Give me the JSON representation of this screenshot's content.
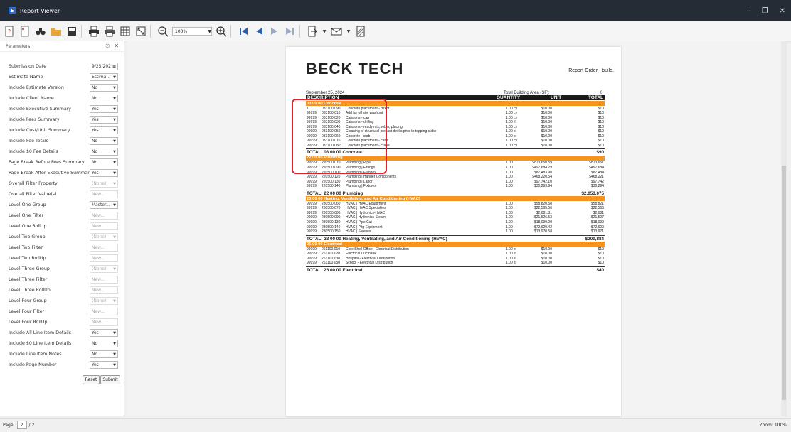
{
  "window": {
    "title": "Report Viewer",
    "app_icon_letter": "E"
  },
  "toolbar": {
    "zoom": "100%"
  },
  "params": {
    "header": "Parameters",
    "rows": [
      {
        "label": "Submission Date",
        "value": "9/25/202",
        "kind": "date",
        "enabled": true
      },
      {
        "label": "Estimate Name",
        "value": "Estima...",
        "kind": "select",
        "enabled": true
      },
      {
        "label": "Include Estimate Version",
        "value": "No",
        "kind": "select",
        "enabled": true
      },
      {
        "label": "Include Client Name",
        "value": "No",
        "kind": "select",
        "enabled": true
      },
      {
        "label": "Include Executive Summary",
        "value": "Yes",
        "kind": "select",
        "enabled": true
      },
      {
        "label": "Include Fees Summary",
        "value": "Yes",
        "kind": "select",
        "enabled": true
      },
      {
        "label": "Include Cost/Unit Summary",
        "value": "Yes",
        "kind": "select",
        "enabled": true
      },
      {
        "label": "Include Fee Totals",
        "value": "No",
        "kind": "select",
        "enabled": true
      },
      {
        "label": "Include $0 Fee Details",
        "value": "No",
        "kind": "select",
        "enabled": true
      },
      {
        "label": "Page Break Before Fees Summary",
        "value": "No",
        "kind": "select",
        "enabled": true
      },
      {
        "label": "Page Break After Executive Summary",
        "value": "Yes",
        "kind": "select",
        "enabled": true
      },
      {
        "label": "Overall Filter Property",
        "value": "(None)",
        "kind": "select",
        "enabled": false
      },
      {
        "label": "Overall Filter Value(s)",
        "value": "New...",
        "kind": "text",
        "enabled": false
      },
      {
        "label": "Level One Group",
        "value": "Master...",
        "kind": "select",
        "enabled": true
      },
      {
        "label": "Level One Filter",
        "value": "New...",
        "kind": "text",
        "enabled": false
      },
      {
        "label": "Level One RollUp",
        "value": "New...",
        "kind": "text",
        "enabled": false
      },
      {
        "label": "Level Two Group",
        "value": "(None)",
        "kind": "select",
        "enabled": false
      },
      {
        "label": "Level Two Filter",
        "value": "New...",
        "kind": "text",
        "enabled": false
      },
      {
        "label": "Level Two RollUp",
        "value": "New...",
        "kind": "text",
        "enabled": false
      },
      {
        "label": "Level Three Group",
        "value": "(None)",
        "kind": "select",
        "enabled": false
      },
      {
        "label": "Level Three Filter",
        "value": "New...",
        "kind": "text",
        "enabled": false
      },
      {
        "label": "Level Three RollUp",
        "value": "New...",
        "kind": "text",
        "enabled": false
      },
      {
        "label": "Level Four Group",
        "value": "(None)",
        "kind": "select",
        "enabled": false
      },
      {
        "label": "Level Four Filter",
        "value": "New...",
        "kind": "text",
        "enabled": false
      },
      {
        "label": "Level Four RollUp",
        "value": "New...",
        "kind": "text",
        "enabled": false
      },
      {
        "label": "Include All Line Item Details",
        "value": "Yes",
        "kind": "select",
        "enabled": true
      },
      {
        "label": "Include $0 Line Item Details",
        "value": "No",
        "kind": "select",
        "enabled": true
      },
      {
        "label": "Include Line Item Notes",
        "value": "No",
        "kind": "select",
        "enabled": true
      },
      {
        "label": "Include Page Number",
        "value": "Yes",
        "kind": "select",
        "enabled": true
      }
    ],
    "reset_label": "Reset",
    "submit_label": "Submit"
  },
  "report": {
    "logo": "BECK TECH",
    "title": "Report Order - build.",
    "date": "September 25, 2024",
    "area_label": "Total Building Area (SF):",
    "area_value": "0",
    "columns": [
      "DESCRIPTION",
      "QUANTITY",
      "UNIT",
      "TOTAL"
    ],
    "sections": [
      {
        "title": "03 00 00 Concrete",
        "lines": [
          [
            "1",
            "033100.090",
            "Concrete placement - direct",
            "1.00 cy",
            "$10.00",
            "$10"
          ],
          [
            "99999",
            "033100.010",
            "Add for off site washout",
            "1.00 cy",
            "$10.00",
            "$10"
          ],
          [
            "99999",
            "033100.020",
            "Caissons - cap",
            "1.00 cy",
            "$10.00",
            "$10"
          ],
          [
            "99999",
            "033100.030",
            "Caissons - drilling",
            "1.00 lf",
            "$10.00",
            "$10"
          ],
          [
            "99999",
            "033100.040",
            "Caissons - ready-mix, rebar, placing",
            "1.00 cy",
            "$10.00",
            "$10"
          ],
          [
            "99999",
            "033100.050",
            "Cleaning of structural precast decks prior to topping slabs",
            "1.00 sf",
            "$10.00",
            "$10"
          ],
          [
            "99999",
            "033100.060",
            "Concrete - curb",
            "1.00 sf",
            "$10.00",
            "$10"
          ],
          [
            "99999",
            "033100.070",
            "Concrete placement - carts",
            "1.00 cy",
            "$10.00",
            "$10"
          ],
          [
            "99999",
            "033100.080",
            "Concrete placement - crane",
            "1.00 cy",
            "$10.00",
            "$10"
          ]
        ],
        "total_label": "TOTAL: 03 00 00 Concrete",
        "total": "$90"
      },
      {
        "title": "22 00 00 Plumbing",
        "lines": [
          [
            "99999",
            "220500.070",
            "Plumbing | Pipe",
            "1.00 .",
            "$873,650.59",
            "$873,651"
          ],
          [
            "99999",
            "220500.090",
            "Plumbing | Fittings",
            "1.00 .",
            "$497,684.29",
            "$497,684"
          ],
          [
            "99999",
            "220500.100",
            "Plumbing | Flanges",
            "1.00 .",
            "$87,483.90",
            "$87,484"
          ],
          [
            "99999",
            "220500.120",
            "Plumbing | Hanger Components",
            "1.00 .",
            "$468,220.54",
            "$468,221"
          ],
          [
            "99999",
            "220500.130",
            "Plumbing | Labor",
            "1.00 .",
            "$97,742.10",
            "$97,742"
          ],
          [
            "99999",
            "220500.140",
            "Plumbing | Fixtures",
            "1.00 .",
            "$30,293.94",
            "$30,294"
          ]
        ],
        "total_label": "TOTAL: 22 00 00 Plumbing",
        "total": "$2,053,075"
      },
      {
        "title": "23 00 00 Heating, Ventilating, and Air Conditioning (HVAC)",
        "lines": [
          [
            "99999",
            "230500.060",
            "HVAC | HVAC Equipment",
            "1.00 .",
            "$58,820.58",
            "$58,821"
          ],
          [
            "99999",
            "230500.070",
            "HVAC | HVAC Specialties",
            "1.00 .",
            "$22,565.50",
            "$22,566"
          ],
          [
            "99999",
            "230500.080",
            "HVAC | Hydronics-HVAC",
            "1.00 .",
            "$2,681.31",
            "$2,681"
          ],
          [
            "99999",
            "230500.090",
            "HVAC | Hydronics-Steam",
            "1.00 .",
            "$21,526.53",
            "$21,527"
          ],
          [
            "99999",
            "230500.130",
            "HVAC | Pipe Cut",
            "1.00 .",
            "$18,099.00",
            "$18,099"
          ],
          [
            "99999",
            "230500.140",
            "HVAC | Pltg Equipment",
            "1.00 .",
            "$72,620.42",
            "$72,620"
          ],
          [
            "99999",
            "230500.150",
            "HVAC | Sleeves",
            "1.00 .",
            "$13,970.58",
            "$13,971"
          ]
        ],
        "total_label": "TOTAL: 23 00 00 Heating, Ventilating, and Air Conditioning (HVAC)",
        "total": "$209,884"
      },
      {
        "title": "26 00 00 Electrical",
        "lines": [
          [
            "99999",
            "261100.010",
            "Core Shell Office - Electrical Distribution",
            "1.00 sf",
            "$10.00",
            "$10"
          ],
          [
            "99999",
            "261100.020",
            "Electrical Ductbank",
            "1.00 lf",
            "$10.00",
            "$10"
          ],
          [
            "99999",
            "261100.030",
            "Hospital - Electrical Distribution",
            "1.00 sf",
            "$10.00",
            "$10"
          ],
          [
            "99999",
            "261100.050",
            "School - Electrical Distribution",
            "1.00 sf",
            "$10.00",
            "$10"
          ]
        ],
        "total_label": "TOTAL: 26 00 00 Electrical",
        "total": "$40"
      }
    ]
  },
  "status": {
    "page_label": "Page:",
    "page_value": "2",
    "page_total": "/ 2",
    "zoom": "Zoom: 100%"
  },
  "colors": {
    "accent_orange": "#f7941d",
    "highlight_red": "#e0202a",
    "titlebar": "#262c36"
  }
}
